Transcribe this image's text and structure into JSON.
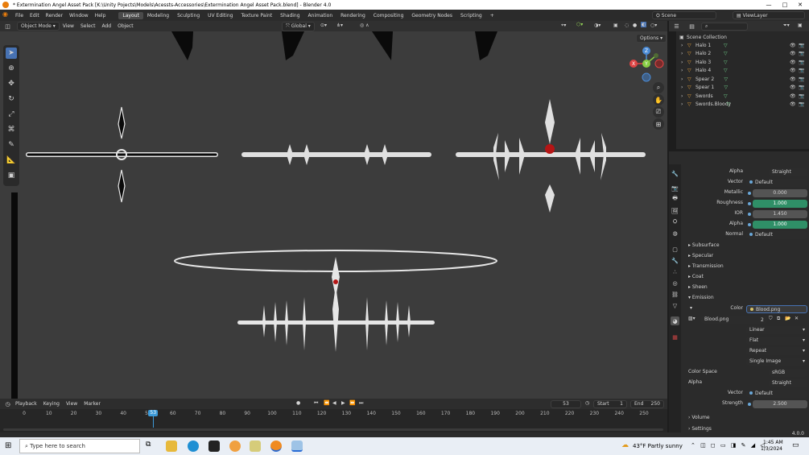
{
  "window": {
    "title": "* Extermination Angel Asset Pack [K:\\Unity Pojects\\Models\\Acessts-Accessories\\Extermination Angel Asset Pack.blend] - Blender 4.0",
    "min": "—",
    "max": "□",
    "close": "✕"
  },
  "menu": [
    "File",
    "Edit",
    "Render",
    "Window",
    "Help"
  ],
  "workspaces": [
    "Layout",
    "Modeling",
    "Sculpting",
    "UV Editing",
    "Texture Paint",
    "Shading",
    "Animation",
    "Rendering",
    "Compositing",
    "Geometry Nodes",
    "Scripting"
  ],
  "workspace_add": "+",
  "scene": "Scene",
  "view_layer": "ViewLayer",
  "viewport_header": {
    "mode": "Object Mode",
    "view": "View",
    "select": "Select",
    "add": "Add",
    "object": "Object",
    "orientation": "Global",
    "options": "Options"
  },
  "gizmo": {
    "x": "X",
    "y": "Y",
    "z": "Z"
  },
  "outliner": {
    "collection": "Scene Collection",
    "items": [
      "Halo 1",
      "Halo 2",
      "Halo 3",
      "Halo 4",
      "Spear 2",
      "Spear 1",
      "Swords",
      "Swords.Bloody"
    ]
  },
  "properties": {
    "alpha_top": {
      "label": "Alpha",
      "value": "Straight"
    },
    "vector": {
      "label": "Vector",
      "value": "Default"
    },
    "metallic": {
      "label": "Metallic",
      "value": "0.000"
    },
    "roughness": {
      "label": "Roughness",
      "value": "1.000"
    },
    "ior": {
      "label": "IOR",
      "value": "1.450"
    },
    "alpha": {
      "label": "Alpha",
      "value": "1.000"
    },
    "normal": {
      "label": "Normal",
      "value": "Default"
    },
    "sections": [
      "Subsurface",
      "Specular",
      "Transmission",
      "Coat",
      "Sheen",
      "Emission"
    ],
    "emission_color": {
      "label": "Color",
      "value": "Blood.png"
    },
    "image": {
      "name": "Blood.png",
      "users": "2"
    },
    "interp": "Linear",
    "proj": "Flat",
    "ext": "Repeat",
    "src": "Single Image",
    "color_space": {
      "label": "Color Space",
      "value": "sRGB"
    },
    "alpha2": {
      "label": "Alpha",
      "value": "Straight"
    },
    "vector2": {
      "label": "Vector",
      "value": "Default"
    },
    "strength": {
      "label": "Strength",
      "value": "2.500"
    },
    "volume": "Volume",
    "settings": "Settings",
    "version": "4.0.0"
  },
  "timeline": {
    "playback": "Playback",
    "keying": "Keying",
    "view": "View",
    "marker": "Marker",
    "current_frame": "53",
    "start_label": "Start",
    "start": "1",
    "end_label": "End",
    "end": "250",
    "ruler": [
      "0",
      "10",
      "20",
      "30",
      "40",
      "50",
      "60",
      "70",
      "80",
      "90",
      "100",
      "110",
      "120",
      "130",
      "140",
      "150",
      "160",
      "170",
      "180",
      "190",
      "200",
      "210",
      "220",
      "230",
      "240",
      "250"
    ],
    "playhead": "53"
  },
  "taskbar": {
    "search": "Type here to search",
    "weather": "43°F Partly sunny",
    "time": "1:45 AM",
    "date": "1/3/2024"
  }
}
